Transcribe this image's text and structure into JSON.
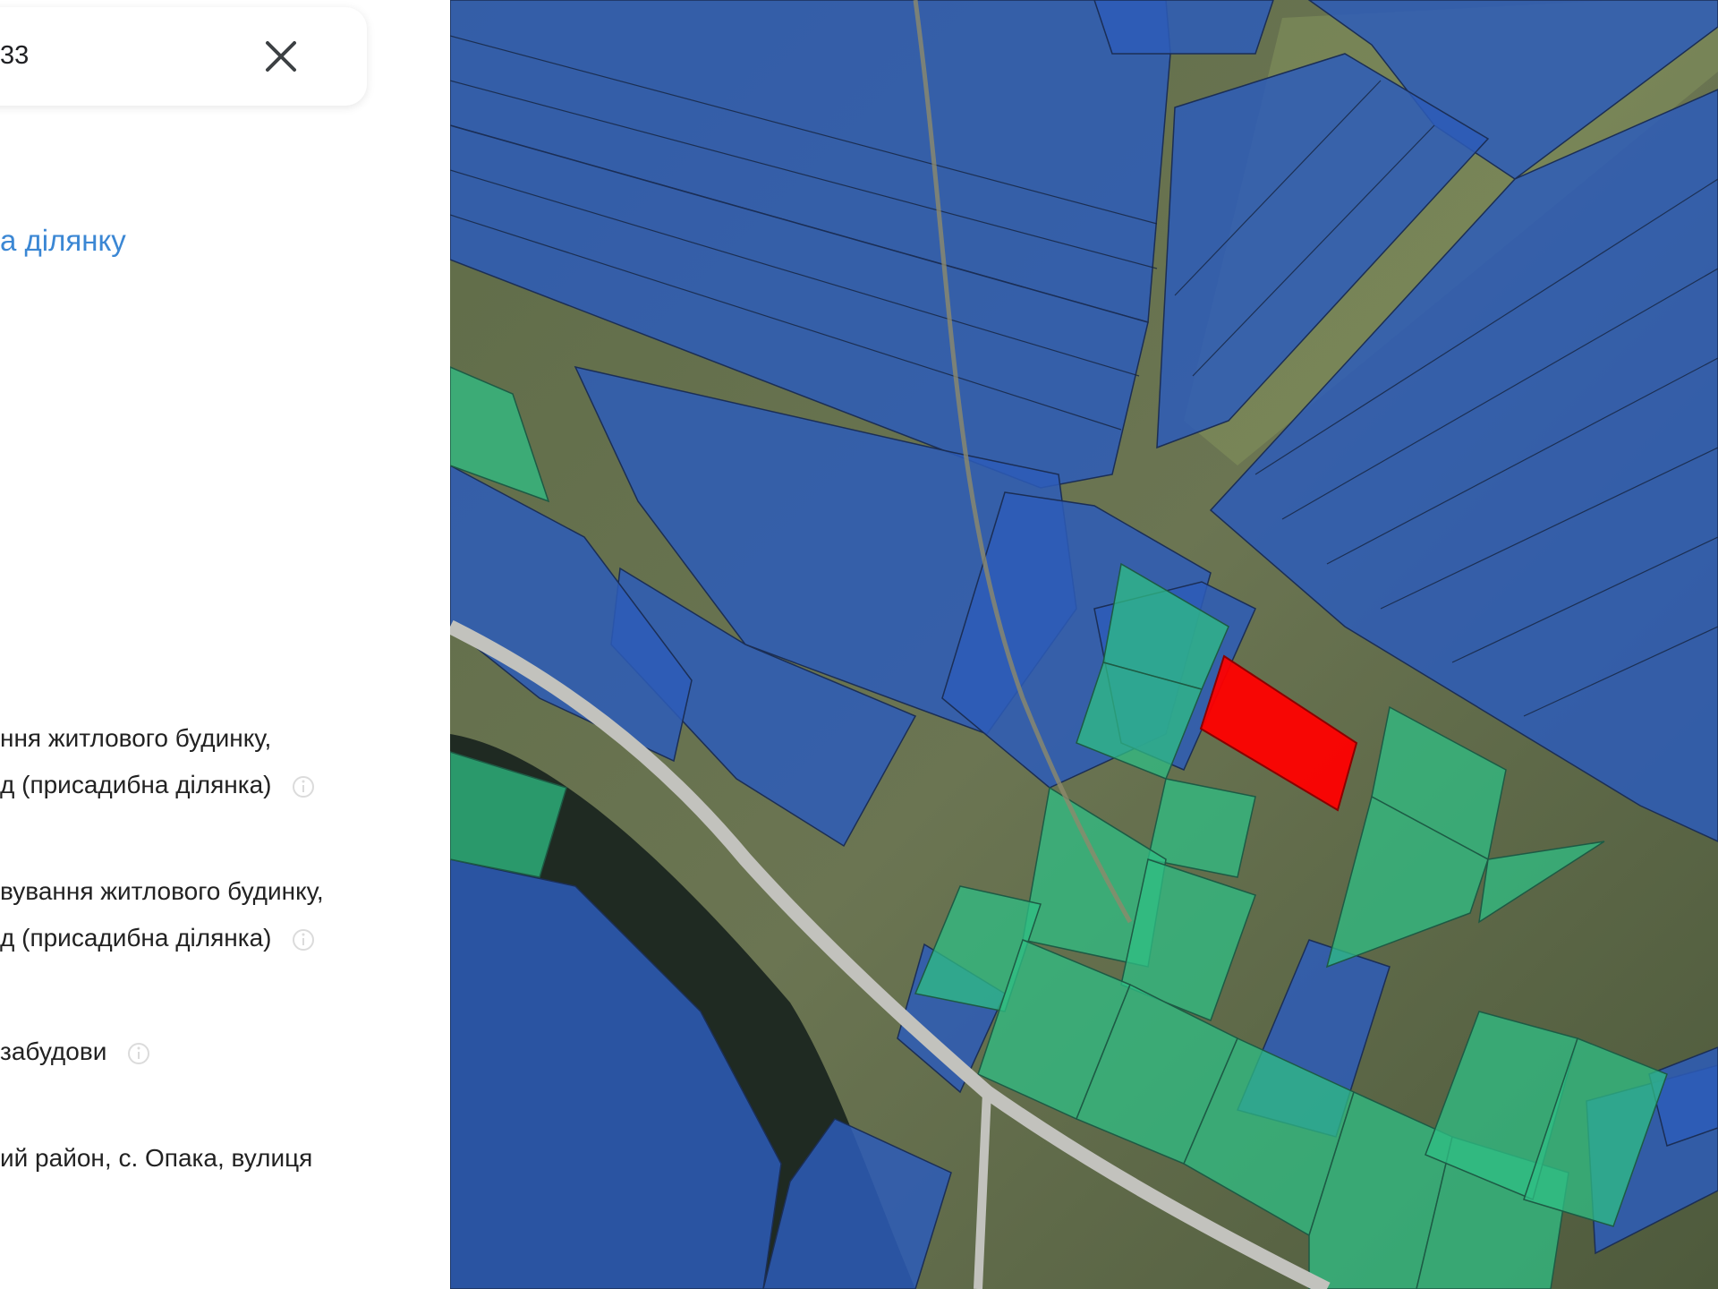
{
  "search": {
    "value": "33"
  },
  "panel": {
    "link_text": "а ділянку",
    "purpose_lines": [
      "ння житлового будинку,",
      "д (присадибна ділянка)"
    ],
    "category_lines": [
      "вування житлового будинку,",
      "д (присадибна ділянка)"
    ],
    "ownership_line": "забудови",
    "address_line": "ий район, с. Опака, вулиця"
  },
  "map": {
    "layers": {
      "private": {
        "color": "#2d5cb8"
      },
      "communal": {
        "color": "#2fbf84"
      },
      "selected": {
        "color": "#ff0000"
      }
    },
    "background_color": "#5b6a44",
    "road_color": "#c2c2bd"
  }
}
